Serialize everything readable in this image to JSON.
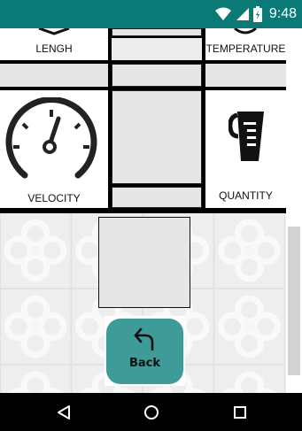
{
  "status_bar": {
    "time": "9:48",
    "icons": [
      "wifi-icon",
      "signal-icon",
      "battery-icon"
    ]
  },
  "grid": {
    "tiles": [
      {
        "label": "LENGH",
        "icon": "ruler-icon"
      },
      {
        "label": "TEMPERATURE",
        "icon": "thermometer-icon"
      },
      {
        "label": "VELOCITY",
        "icon": "speedometer-icon"
      },
      {
        "label": "QUANTITY",
        "icon": "measuring-cup-icon"
      }
    ]
  },
  "back_button": {
    "label": "Back",
    "icon": "back-arrow-icon"
  },
  "nav_bar": {
    "buttons": [
      "back-triangle-icon",
      "home-circle-icon",
      "recents-square-icon"
    ]
  },
  "colors": {
    "status_bar": "#0b7a76",
    "back_button": "#3e9b97",
    "tile_background": "#e6e6e6"
  }
}
